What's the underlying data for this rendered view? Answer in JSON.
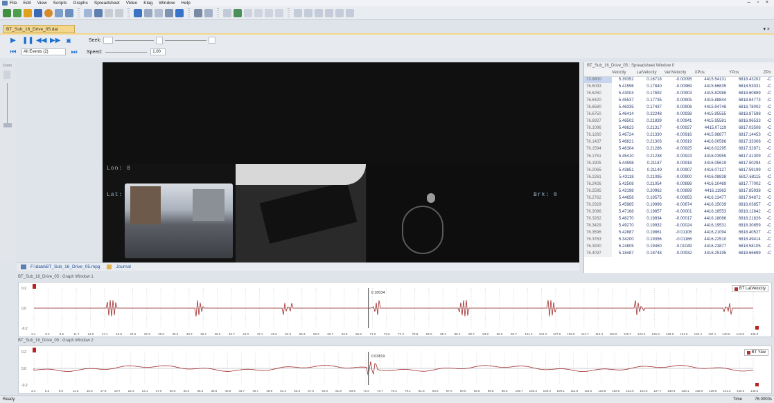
{
  "menu": [
    "File",
    "Edit",
    "View",
    "Scripts",
    "Graphs",
    "Spreadsheet",
    "Video",
    "Klag",
    "Window",
    "Help"
  ],
  "window_controls": "– ▫ ×",
  "doc_tab": "BT_Sub_16_Drive_05.dat",
  "tab_close": "▾ ×",
  "seek_label": "Seek:",
  "speed_label": "Speed:",
  "speed_value": "1.00",
  "events_select": "All Events (2)",
  "left_panel_label": "Zoom",
  "video_overlays": {
    "lon": "Lon: 0",
    "lat": "Lat:",
    "brk": "Brk: 0"
  },
  "video_tabs": {
    "mpg": "F:\\data\\BT_Sub_16_Drive_05.mpg",
    "journal": "Journal"
  },
  "spreadsheet": {
    "title": "BT_Sub_16_Drive_05 : Spreadsheet Window 0",
    "columns": [
      "",
      "Velocity",
      "LatVelocity",
      "VertVelocity",
      "XPos",
      "YPos",
      "ZPo"
    ],
    "rows": [
      [
        "73.9800",
        "5.39352",
        "0.16718",
        "-0.00095",
        "4415.54131",
        "6818.43202",
        "-C"
      ],
      [
        "76.6093",
        "5.41596",
        "0.17840",
        "-0.00969",
        "4415.66835",
        "6818.53031",
        "-C"
      ],
      [
        "76.6250",
        "5.43004",
        "0.17692",
        "-0.00903",
        "4415.82988",
        "6818.60889",
        "-C"
      ],
      [
        "76.6420",
        "5.45537",
        "0.17735",
        "-0.00905",
        "4415.88844",
        "6818.64773",
        "-C"
      ],
      [
        "76.6580",
        "5.46335",
        "0.17437",
        "-0.00906",
        "4415.94748",
        "6818.78002",
        "-C"
      ],
      [
        "76.6750",
        "5.46414",
        "0.22248",
        "-0.00938",
        "4415.95555",
        "6818.87598",
        "-C"
      ],
      [
        "76.6927",
        "5.46502",
        "0.21839",
        "-0.00941",
        "4415.95581",
        "6816.96533",
        "-C"
      ],
      [
        "76.1096",
        "5.46623",
        "0.21317",
        "-0.00927",
        "4415.07119",
        "6817.03508",
        "-C"
      ],
      [
        "76.1260",
        "5.46724",
        "0.21330",
        "-0.00916",
        "4415.98877",
        "6817.14453",
        "-C"
      ],
      [
        "76.1437",
        "5.46821",
        "0.21303",
        "-0.00919",
        "4416.00586",
        "6817.33308",
        "-C"
      ],
      [
        "76.1594",
        "5.46304",
        "0.21286",
        "-0.00925",
        "4416.02295",
        "6817.32871",
        "-C"
      ],
      [
        "76.1751",
        "5.45410",
        "0.21238",
        "-0.00923",
        "4416.03959",
        "6817.41309",
        "-C"
      ],
      [
        "76.1905",
        "5.44598",
        "0.21187",
        "-0.00918",
        "4416.05619",
        "6817.50294",
        "-C"
      ],
      [
        "76.2065",
        "5.43851",
        "0.21149",
        "-0.00907",
        "4416.07127",
        "6817.59199",
        "-C"
      ],
      [
        "76.2261",
        "5.43118",
        "0.21095",
        "-0.00900",
        "4416.08838",
        "6817.68115",
        "-C"
      ],
      [
        "76.2426",
        "5.42508",
        "0.21054",
        "-0.00898",
        "4416.10469",
        "6817.77002",
        "-C"
      ],
      [
        "76.2595",
        "5.43198",
        "0.20962",
        "-0.00899",
        "4416.11963",
        "6817.85938",
        "-C"
      ],
      [
        "76.2762",
        "5.44658",
        "0.19575",
        "-0.00853",
        "4416.13477",
        "6817.94872",
        "-C"
      ],
      [
        "76.2929",
        "5.45985",
        "0.19996",
        "-0.00674",
        "4416.15039",
        "6818.03857",
        "-C"
      ],
      [
        "76.3096",
        "5.47168",
        "0.19857",
        "-0.00001",
        "4416.16553",
        "6818.12842",
        "-C"
      ],
      [
        "76.3262",
        "5.48270",
        "0.19934",
        "-0.00017",
        "4416.18066",
        "6818.21826",
        "-C"
      ],
      [
        "76.3429",
        "5.49270",
        "0.19932",
        "-0.00024",
        "4416.19531",
        "6818.30859",
        "-C"
      ],
      [
        "76.3596",
        "5.42887",
        "0.19861",
        "-0.01106",
        "4416.21094",
        "6818.40527",
        "-C"
      ],
      [
        "76.3763",
        "5.34200",
        "0.19356",
        "-0.01166",
        "4416.22510",
        "6818.49414",
        "-C"
      ],
      [
        "76.3930",
        "5.24805",
        "0.19450",
        "-0.01049",
        "4416.23877",
        "6818.58105",
        "-C"
      ],
      [
        "76.4097",
        "5.18487",
        "0.18748",
        "-0.00932",
        "4416.25195",
        "6818.66699",
        "-C"
      ]
    ]
  },
  "graph1": {
    "title": "BT_Sub_16_Drive_05 : Graph Window 1",
    "legend": "BT LatVelocity",
    "cursor_value": "0.18034",
    "yticks": [
      "0.2",
      "0.0",
      "-0.2"
    ],
    "xticks": [
      "3.4",
      "8.2",
      "8.6",
      "11.7",
      "14.6",
      "17.1",
      "18.8",
      "22.6",
      "25.3",
      "28.6",
      "30.5",
      "33.2",
      "36.2",
      "38.6",
      "40.7",
      "44.0",
      "47.1",
      "49.6",
      "52.5",
      "55.3",
      "58.2",
      "60.7",
      "63.8",
      "66.8",
      "71.0",
      "73.6",
      "77.3",
      "79.8",
      "82.6",
      "85.3",
      "88.4",
      "90.7",
      "93.8",
      "96.0",
      "98.7",
      "101.4",
      "104.3",
      "107.6",
      "109.8",
      "112.7",
      "115.3",
      "118.0",
      "120.7",
      "123.2",
      "126.3",
      "128.8",
      "131.6",
      "134.4",
      "137.1",
      "140.8",
      "142.8",
      "145.0"
    ]
  },
  "graph2": {
    "title": "BT_Sub_16_Drive_05 : Graph Window 2",
    "legend": "BT Yaw",
    "cursor_value": "0.03819",
    "yticks": [
      "0.2",
      "0.0",
      "-0.2"
    ],
    "xticks": [
      "3.4",
      "8.2",
      "8.0",
      "11.6",
      "15.0",
      "17.9",
      "19.7",
      "22.4",
      "24.1",
      "27.6",
      "30.6",
      "33.2",
      "36.2",
      "38.6",
      "40.5",
      "43.7",
      "46.7",
      "48.8",
      "51.4",
      "53.9",
      "57.6",
      "60.0",
      "61.8",
      "63.5",
      "71.0",
      "73.7",
      "76.4",
      "79.1",
      "81.8",
      "84.8",
      "87.0",
      "90.0",
      "92.8",
      "95.8",
      "98.6",
      "100.7",
      "103.4",
      "106.4",
      "109.1",
      "111.8",
      "114.2",
      "116.8",
      "119.6",
      "122.0",
      "124.5",
      "127.7",
      "130.4",
      "133.1",
      "136.0",
      "138.6",
      "141.3",
      "145.0",
      "148.6"
    ]
  },
  "status_left": "Ready",
  "status_time_label": "Time",
  "status_time_value": "76.0000s"
}
